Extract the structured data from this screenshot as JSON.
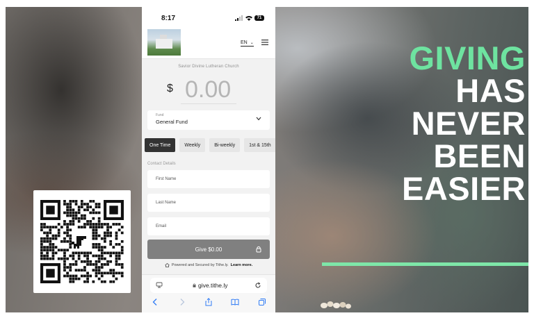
{
  "phone": {
    "status": {
      "time": "8:17",
      "battery": "71"
    },
    "header": {
      "language": "EN"
    },
    "church_name": "Savior Divine Lutheran Church",
    "donation": {
      "currency": "$",
      "amount": "0.00"
    },
    "fund": {
      "label": "Fund",
      "value": "General Fund"
    },
    "frequency_options": [
      {
        "label": "One Time",
        "active": true
      },
      {
        "label": "Weekly",
        "active": false
      },
      {
        "label": "Bi-weekly",
        "active": false
      },
      {
        "label": "1st & 15th",
        "active": false
      }
    ],
    "contact": {
      "section_label": "Contact Details",
      "first_name_placeholder": "First Name",
      "last_name_placeholder": "Last Name",
      "email_placeholder": "Email"
    },
    "give_button": "Give $0.00",
    "powered": {
      "text": "Powered and Secured by Tithe.ly.",
      "link": "Learn more."
    },
    "browser": {
      "url": "give.tithe.ly"
    }
  },
  "headline": {
    "accent_word": "GIVING",
    "rest": [
      "HAS",
      "NEVER",
      "BEEN",
      "EASIER"
    ]
  },
  "colors": {
    "accent_green": "#6ee3a0",
    "give_button": "#808080",
    "active_tab": "#333333"
  }
}
